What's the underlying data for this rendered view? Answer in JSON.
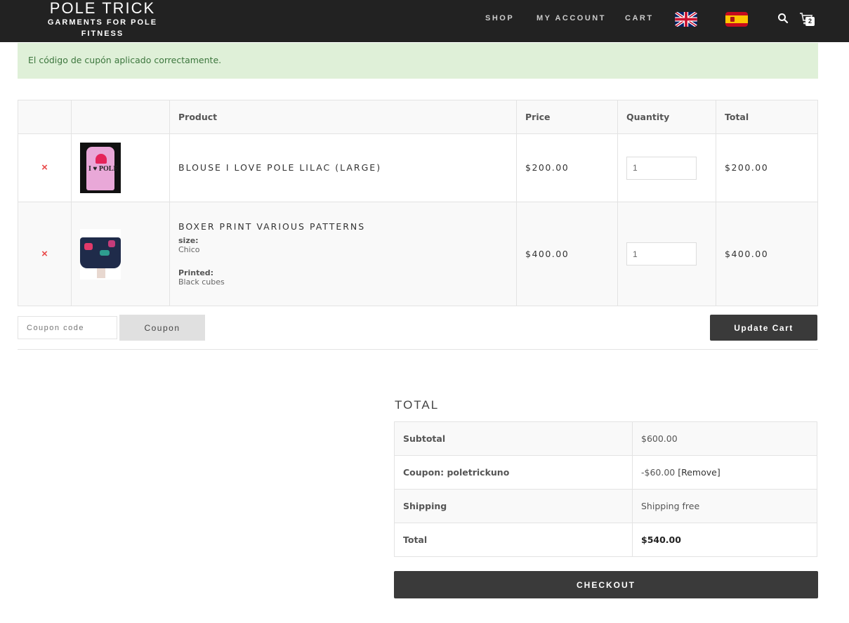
{
  "header": {
    "logo_title": "POLE TRICK",
    "logo_subtitle_line1": "GARMENTS FOR POLE",
    "logo_subtitle_line2": "FITNESS",
    "nav": [
      "SHOP",
      "MY ACCOUNT",
      "CART"
    ],
    "cart_count": "2",
    "icons": [
      "uk-flag-icon",
      "spain-flag-icon",
      "search-icon",
      "cart-icon"
    ]
  },
  "notice": {
    "text": "El código de cupón aplicado correctamente."
  },
  "cart": {
    "headers": [
      "",
      "",
      "Product",
      "Price",
      "Quantity",
      "Total"
    ],
    "items": [
      {
        "remove": "×",
        "name": "BLOUSE I LOVE POLE LILAC (LARGE)",
        "price": "$200.00",
        "quantity": "1",
        "total": "$200.00",
        "thumb_text": "I ♥ POLE"
      },
      {
        "remove": "×",
        "name": "BOXER PRINT VARIOUS PATTERNS",
        "meta": [
          {
            "label": "size:",
            "value": "Chico"
          },
          {
            "label": "Printed:",
            "value": "Black cubes"
          }
        ],
        "price": "$400.00",
        "quantity": "1",
        "total": "$400.00"
      }
    ]
  },
  "actions": {
    "coupon_placeholder": "Coupon code",
    "coupon_button": "Coupon",
    "update_button": "Update Cart"
  },
  "totals": {
    "heading": "TOTAL",
    "rows": [
      {
        "label": "Subtotal",
        "value": "$600.00"
      },
      {
        "label": "Coupon: poletrickuno",
        "value": "-$60.00",
        "link": "[Remove]"
      },
      {
        "label": "Shipping",
        "value": "Shipping free"
      },
      {
        "label": "Total",
        "value": "$540.00"
      }
    ],
    "checkout_button": "CHECKOUT"
  },
  "colors": {
    "header_bg": "#222222",
    "notice_bg": "#dff0d8",
    "notice_text": "#3c763d",
    "remove_red": "#e94b4b",
    "button_dark": "#3a3a3a"
  }
}
